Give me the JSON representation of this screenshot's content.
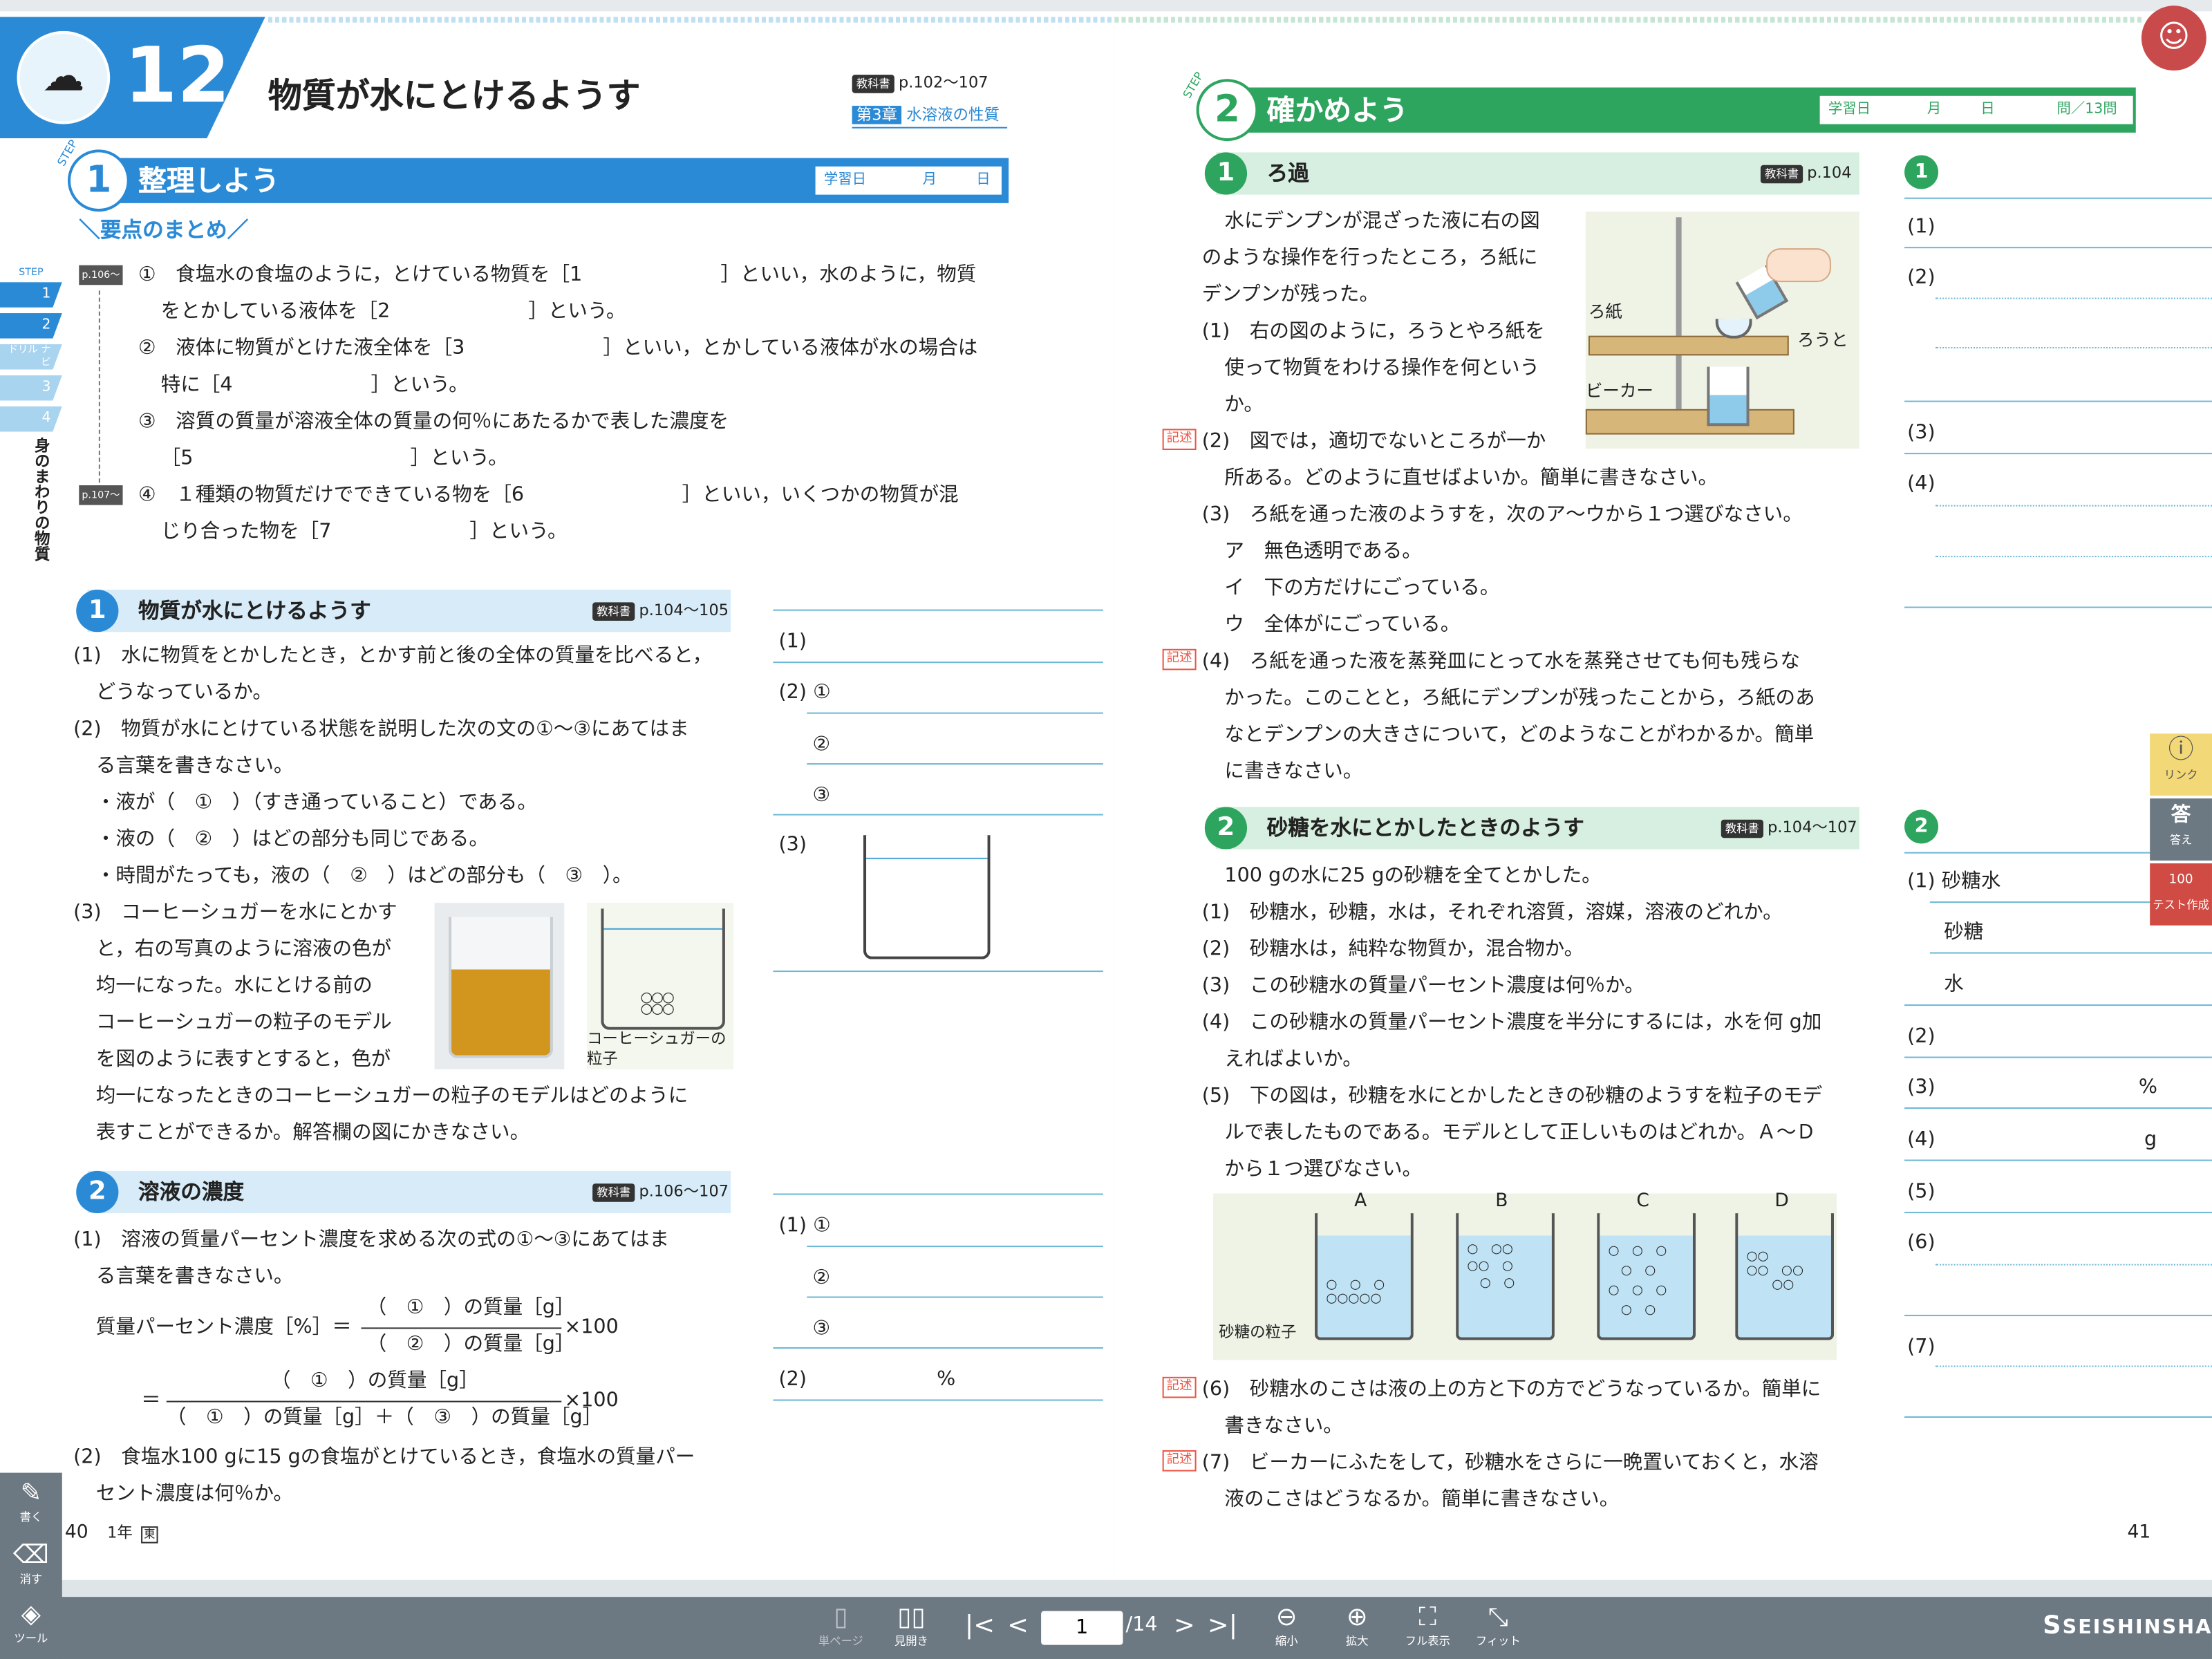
{
  "left": {
    "unit_number": "12",
    "unit_title": "物質が水にとけるようす",
    "ref_pages": "p.102～107",
    "textbook_tag": "教科書",
    "chapter_tag": "第3章",
    "chapter_name": "水溶液の性質",
    "step_label": "STEP",
    "step1_num": "1",
    "step1_title": "整理しよう",
    "study_date": "学習日",
    "month": "月",
    "day": "日",
    "summary_title": "要点のまとめ",
    "step_nav": [
      "1",
      "2",
      "ドリル ナビ",
      "3",
      "4"
    ],
    "vertical_label": "身のまわりの物質",
    "ref1": "p.106～",
    "ref2": "p.107～",
    "summary_lines": [
      "①　食塩水の食塩のように，とけている物質を［1　　　　　　　］といい，水のように，物質",
      "をとかしている液体を［2　　　　　　　］という。",
      "②　液体に物質がとけた液全体を［3　　　　　　　］といい，とかしている液体が水の場合は",
      "特に［4　　　　　　　］という。",
      "③　溶質の質量が溶液全体の質量の何％にあたるかで表した濃度を",
      "［5　　　　　　　　　　　］という。",
      "④　１種類の物質だけでできている物を［6　　　　　　　　］といい，いくつかの物質が混",
      "じり合った物を［7　　　　　　　］という。"
    ],
    "q1_title": "物質が水にとけるようす",
    "q1_ref": "p.104～105",
    "q1_lines": [
      "(1)　水に物質をとかしたとき，とかす前と後の全体の質量を比べると，",
      "どうなっているか。",
      "(2)　物質が水にとけている状態を説明した次の文の①～③にあてはま",
      "る言葉を書きなさい。",
      "・液が（　①　）（すき通っていること）である。",
      "・液の（　②　）はどの部分も同じである。",
      "・時間がたっても，液の（　②　）はどの部分も（　③　）。",
      "(3)　コーヒーシュガーを水にとかす",
      "と，右の写真のように溶液の色が",
      "均一になった。水にとける前の",
      "コーヒーシュガーの粒子のモデル",
      "を図のように表すとすると，色が",
      "均一になったときのコーヒーシュガーの粒子のモデルはどのように",
      "表すことができるか。解答欄の図にかきなさい。"
    ],
    "sugar_label": "コーヒーシュガーの粒子",
    "q1_answers": [
      "(1)",
      "(2) ①",
      "②",
      "③",
      "(3)"
    ],
    "q2_title": "溶液の濃度",
    "q2_ref": "p.106～107",
    "q2_lines": [
      "(1)　溶液の質量パーセント濃度を求める次の式の①～③にあてはま",
      "る言葉を書きなさい。"
    ],
    "formula_left": "質量パーセント濃度［%］＝",
    "formula_num1": "（　①　）の質量［g］",
    "formula_den1": "（　②　）の質量［g］",
    "formula_x100": "×100",
    "formula_eq": "＝",
    "formula_num2": "（　①　）の質量［g］",
    "formula_den2": "（　①　）の質量［g］＋（　③　）の質量［g］",
    "q2_tail": [
      "(2)　食塩水100 gに15 gの食塩がとけているとき，食塩水の質量パー",
      "セント濃度は何％か。"
    ],
    "q2_answers": [
      "(1) ①",
      "②",
      "③",
      "(2)"
    ],
    "percent": "%",
    "page_num": "40",
    "grade": "1年"
  },
  "right": {
    "step2_num": "2",
    "step2_title": "確かめよう",
    "study_date": "学習日",
    "month": "月",
    "day": "日",
    "score": "問／13問",
    "r1_title": "ろ過",
    "r1_ref": "p.104",
    "r1_lines": [
      "水にデンプンが混ざった液に右の図",
      "のような操作を行ったところ，ろ紙に",
      "デンプンが残った。",
      "(1)　右の図のように，ろうとやろ紙を",
      "使って物質をわける操作を何という",
      "か。",
      "(2)　図では，適切でないところが一か",
      "所ある。どのように直せばよいか。簡単に書きなさい。",
      "(3)　ろ紙を通った液のようすを，次のア～ウから１つ選びなさい。",
      "ア　無色透明である。",
      "イ　下の方だけにごっている。",
      "ウ　全体がにごっている。",
      "(4)　ろ紙を通った液を蒸発皿にとって水を蒸発させても何も残らな",
      "かった。このことと，ろ紙にデンプンが残ったことから，ろ紙のあ",
      "なとデンプンの大きさについて，どのようなことがわかるか。簡単",
      "に書きなさい。"
    ],
    "fig_labels": {
      "paper": "ろ紙",
      "funnel": "ろうと",
      "beaker": "ビーカー"
    },
    "kijutsu": "記述",
    "r2_title": "砂糖を水にとかしたときのようす",
    "r2_ref": "p.104～107",
    "r2_lines": [
      "100 gの水に25 gの砂糖を全てとかした。",
      "(1)　砂糖水，砂糖，水は，それぞれ溶質，溶媒，溶液のどれか。",
      "(2)　砂糖水は，純粋な物質か，混合物か。",
      "(3)　この砂糖水の質量パーセント濃度は何％か。",
      "(4)　この砂糖水の質量パーセント濃度を半分にするには，水を何 g加",
      "えればよいか。",
      "(5)　下の図は，砂糖を水にとかしたときの砂糖のようすを粒子のモデ",
      "ルで表したものである。モデルとして正しいものはどれか。Ａ～Ｄ",
      "から１つ選びなさい。"
    ],
    "beaker_labels": [
      "A",
      "B",
      "C",
      "D"
    ],
    "particle_label": "砂糖の粒子",
    "r2_tail": [
      "(6)　砂糖水のこさは液の上の方と下の方でどうなっているか。簡単に",
      "書きなさい。",
      "(7)　ビーカーにふたをして，砂糖水をさらに一晩置いておくと，水溶",
      "液のこさはどうなるか。簡単に書きなさい。"
    ],
    "ans1_num": "1",
    "ans1": [
      "(1)",
      "(2)",
      "(3)",
      "(4)"
    ],
    "ans2_num": "2",
    "ans2": [
      "(1) 砂糖水",
      "砂糖",
      "水",
      "(2)",
      "(3)",
      "(4)",
      "(5)",
      "(6)",
      "(7)"
    ],
    "percent": "%",
    "gram": "g",
    "page_num": "41"
  },
  "side": {
    "link": "リンク",
    "answer": "答え",
    "test": "テスト作成",
    "answer_icon": "答",
    "test_icon": "100"
  },
  "tools": {
    "write": "書く",
    "erase": "消す",
    "tool": "ツール"
  },
  "toolbar": {
    "single": "単ページ",
    "spread": "見開き",
    "page_value": "1",
    "page_total": "/14",
    "zoom_out": "縮小",
    "zoom_in": "拡大",
    "full": "フル表示",
    "fit": "フィット",
    "brand": "SEISHINSHA",
    "brand_icon": "S"
  }
}
